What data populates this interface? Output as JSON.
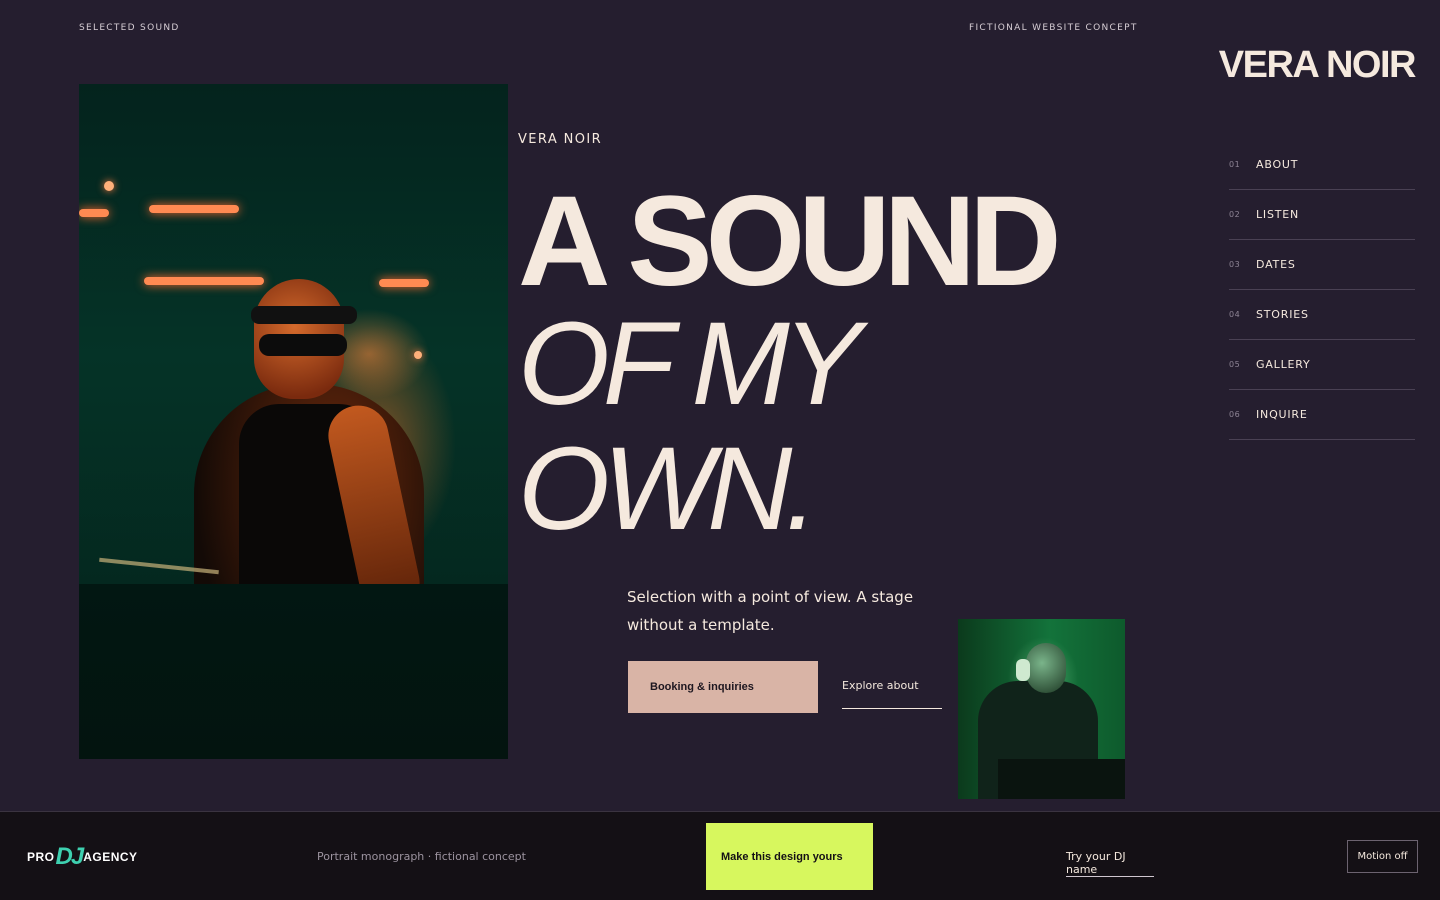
{
  "header": {
    "top_left": "SELECTED SOUND",
    "top_right": "FICTIONAL WEBSITE CONCEPT",
    "brand": "VERA NOIR"
  },
  "hero": {
    "eyebrow": "VERA NOIR",
    "headline_line1": "A SOUND",
    "headline_line2": "OF MY",
    "headline_line3": "OWN.",
    "lede": "Selection with a point of view. A stage without a template.",
    "primary_button": "Booking & inquiries",
    "secondary_link": "Explore about"
  },
  "nav": {
    "items": [
      {
        "num": "01",
        "label": "ABOUT"
      },
      {
        "num": "02",
        "label": "LISTEN"
      },
      {
        "num": "03",
        "label": "DATES"
      },
      {
        "num": "04",
        "label": "STORIES"
      },
      {
        "num": "05",
        "label": "GALLERY"
      },
      {
        "num": "06",
        "label": "INQUIRE"
      }
    ]
  },
  "footer": {
    "logo_left": "PRO",
    "logo_mid": "DJ",
    "logo_right": "AGENCY",
    "caption": "Portrait monograph · fictional concept",
    "cta": "Make this design yours",
    "try_link": "Try your DJ name",
    "motion_button": "Motion off"
  },
  "colors": {
    "background": "#251e2f",
    "text": "#f5e9de",
    "booking_button": "#d9b4a6",
    "cta": "#d7f75e",
    "footer": "#141015"
  }
}
